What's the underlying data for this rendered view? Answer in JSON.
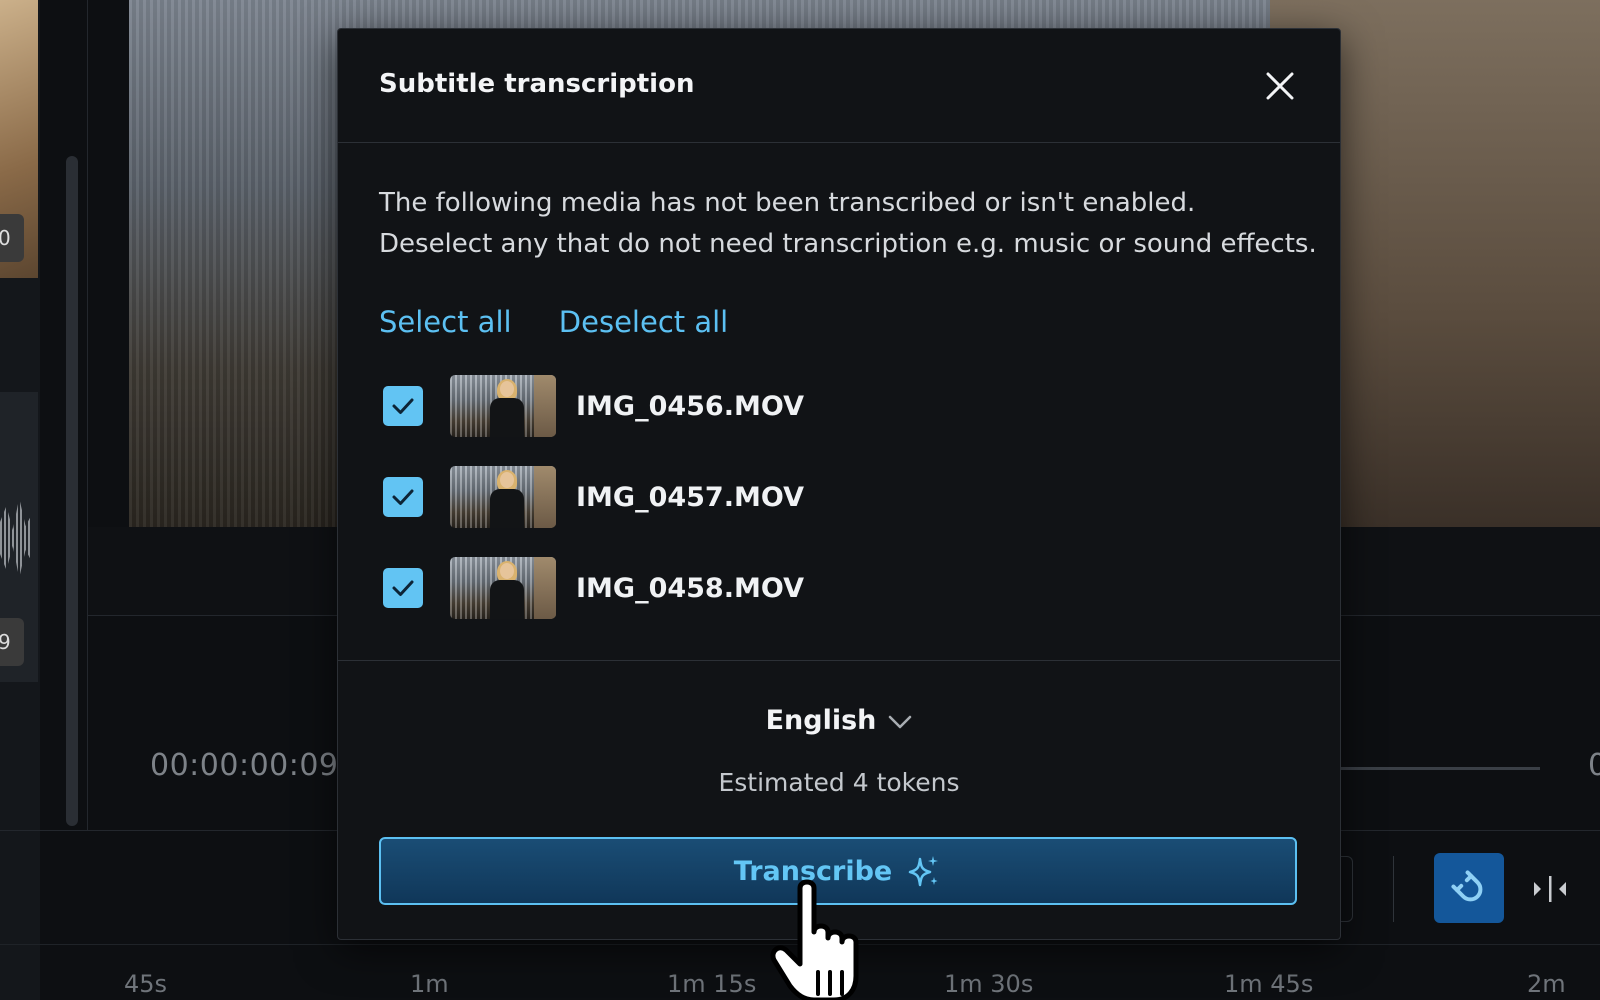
{
  "background": {
    "left_badge_top": "0",
    "left_badge_bottom": "9",
    "timecode": "00:00:00:09",
    "right_partial": "0",
    "ruler_ticks": [
      "45s",
      "1m",
      "1m 15s",
      "1m 30s",
      "1m 45s",
      "2m"
    ]
  },
  "modal": {
    "title": "Subtitle transcription",
    "description_line1": "The following media has not been transcribed or isn't enabled.",
    "description_line2": "Deselect any that do not need transcription e.g. music or sound effects.",
    "select_all": "Select all",
    "deselect_all": "Deselect all",
    "media": [
      {
        "name": "IMG_0456.MOV",
        "checked": true
      },
      {
        "name": "IMG_0457.MOV",
        "checked": true
      },
      {
        "name": "IMG_0458.MOV",
        "checked": true
      }
    ],
    "language": "English",
    "estimate": "Estimated 4 tokens",
    "transcribe_label": "Transcribe"
  },
  "colors": {
    "accent": "#5cc0f2",
    "checkbox": "#62c4f3",
    "button_bg": "#14466c",
    "modal_bg": "#111316"
  },
  "icons": [
    "close-icon",
    "check-icon",
    "chevron-down-icon",
    "sparkle-icon",
    "magnet-icon",
    "split-icon",
    "hand-pointer-cursor"
  ]
}
